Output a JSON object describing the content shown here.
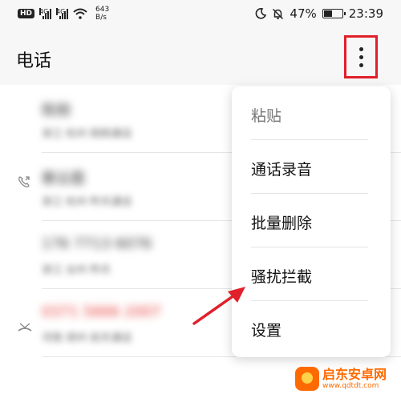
{
  "status_bar": {
    "hd_badge": "HD",
    "net1": "4G",
    "net2": "4G",
    "speed_value": "643",
    "speed_unit": "B/s",
    "battery_percent": "47%",
    "battery_level": 0.47,
    "time": "23:39",
    "icons": [
      "hd-icon",
      "signal-icon",
      "wifi-icon",
      "moon-icon",
      "mute-bell-icon",
      "battery-icon"
    ]
  },
  "header": {
    "title": "电话",
    "more_icon": "more-vertical-icon",
    "highlight_color": "#e0202a"
  },
  "calls": [
    {
      "name": "陈刚",
      "sub": "浙江 杭州 刚刚通话",
      "icon": "",
      "missed": false
    },
    {
      "name": "蔡云霞",
      "sub": "浙江 杭州 昨天通话",
      "icon": "call-forward-icon",
      "missed": false
    },
    {
      "name": "176 7713 6076",
      "sub": "浙江 台州 昨天",
      "icon": "",
      "missed": false
    },
    {
      "name": "0371 5666 2007",
      "sub": "河南 郑州 前天通话",
      "icon": "missed-call-icon",
      "missed": true
    }
  ],
  "menu": {
    "items": [
      {
        "label": "粘贴",
        "enabled": false
      },
      {
        "label": "通话录音",
        "enabled": true
      },
      {
        "label": "批量删除",
        "enabled": true
      },
      {
        "label": "骚扰拦截",
        "enabled": true
      },
      {
        "label": "设置",
        "enabled": true
      }
    ]
  },
  "annotation": {
    "arrow_color": "#e0202a"
  },
  "watermark": {
    "name": "启东安卓网",
    "url": "www.qdtdt.com"
  }
}
